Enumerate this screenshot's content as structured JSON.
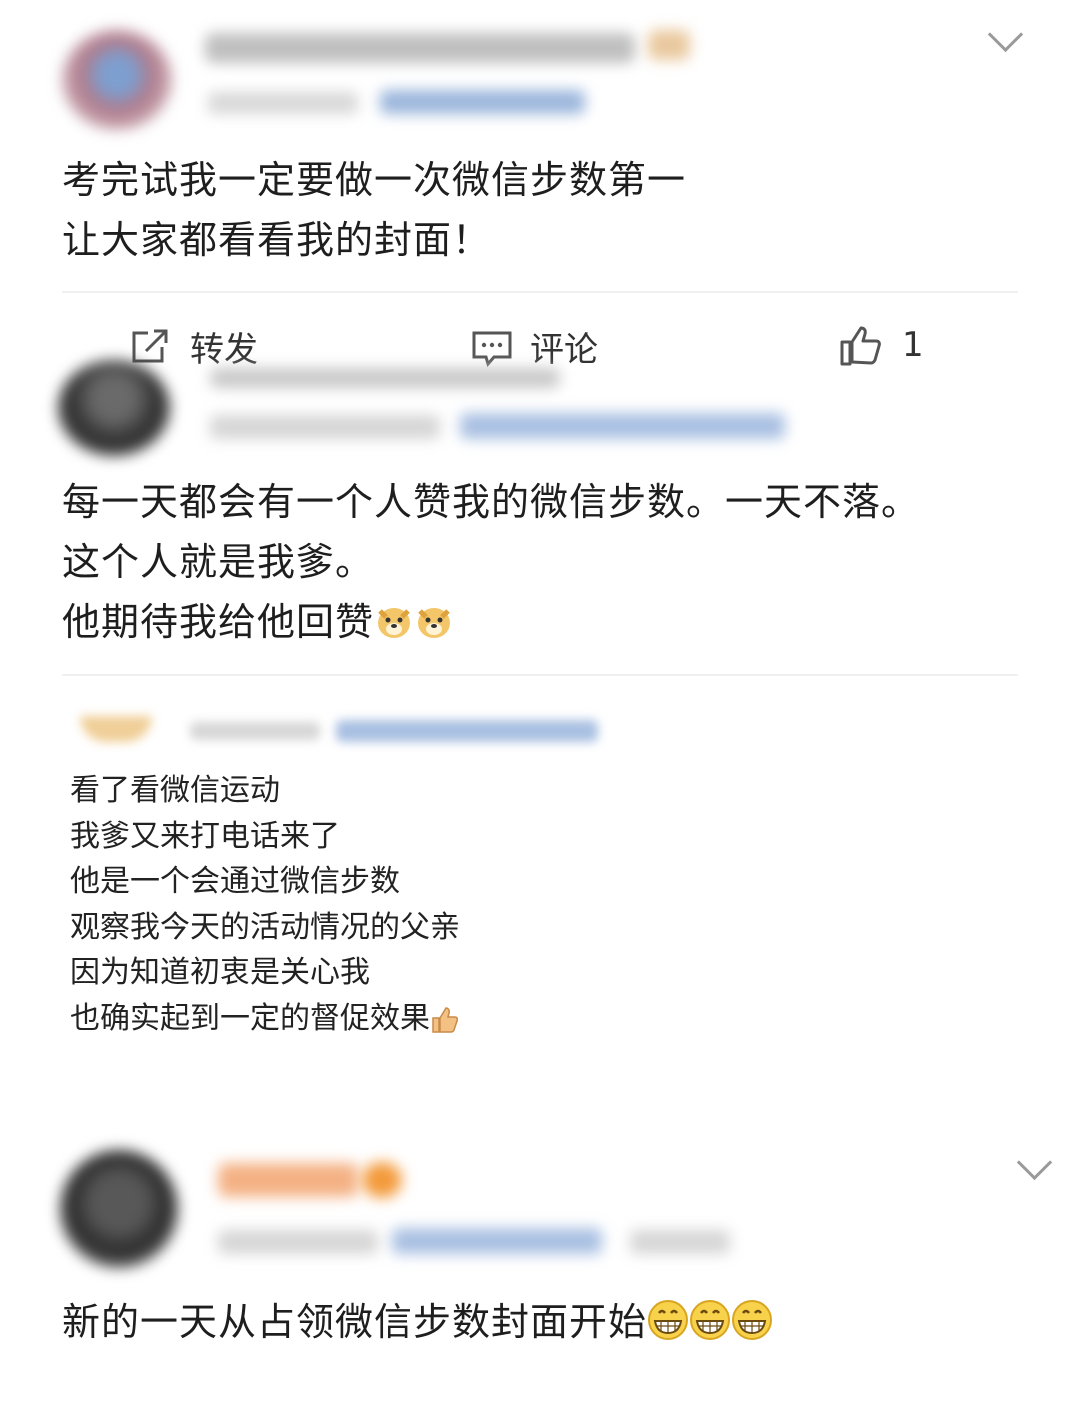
{
  "posts": [
    {
      "lines": [
        "考完试我一定要做一次微信步数第一",
        "让大家都看看我的封面！"
      ],
      "actions": {
        "repost_label": "转发",
        "comment_label": "评论",
        "like_count": "1"
      }
    },
    {
      "lines": [
        "每一天都会有一个人赞我的微信步数。一天不落。",
        "这个人就是我爹。",
        "他期待我给他回赞"
      ]
    },
    {
      "lines": [
        "看了看微信运动",
        "我爹又来打电话来了",
        "他是一个会通过微信步数",
        "观察我今天的活动情况的父亲",
        "因为知道初衷是关心我",
        "也确实起到一定的督促效果"
      ]
    },
    {
      "lines": [
        "新的一天从占领微信步数封面开始"
      ]
    }
  ],
  "icons": {
    "chevron": "chevron-down-icon",
    "repost": "share-icon",
    "comment": "comment-icon",
    "like": "thumbs-up-icon",
    "doge": "doge-emoji",
    "thumb": "thumbs-up-emoji",
    "grin": "grin-emoji"
  },
  "colors": {
    "blur_blue": "#9bb6dc",
    "blur_orange": "#f2a56a",
    "divider": "#efefef"
  }
}
